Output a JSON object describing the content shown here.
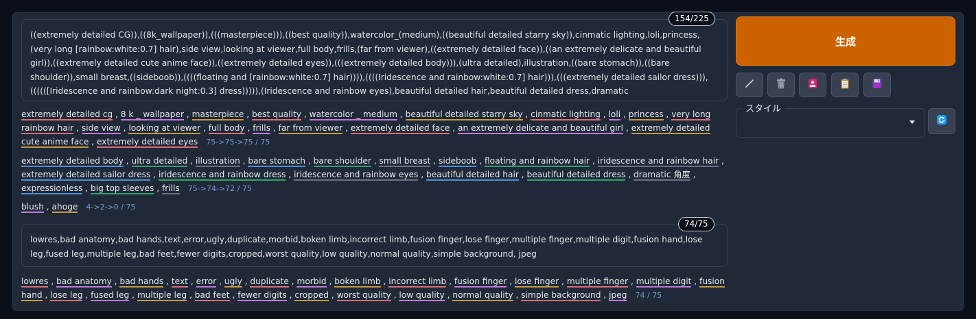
{
  "positive_prompt": {
    "counter": "154/225",
    "text": "((extremely detailed CG)),((8k_wallpaper)),(((masterpiece))),((best quality)),watercolor_(medium),((beautiful detailed starry sky)),cinmatic lighting,loli,princess,(very long [rainbow:white:0.7] hair),side view,looking at viewer,full body,frills,(far from viewer),((extremely detailed face)),((an extremely delicate and beautiful girl)),((extremely detailed cute anime face)),((extremely detailed eyes)),(((extremely detailed body))),(ultra detailed),illustration,((bare stomach)),((bare shoulder)),small breast,((sideboob)),((((floating and [rainbow:white:0.7] hair)))),((((Iridescence and rainbow:white:0.7] hair))),(((extremely detailed sailor dress))),((((([Iridescence and rainbow:dark night:0.3] dress))))),(Iridescence and rainbow eyes),beautiful detailed hair,beautiful detailed dress,dramatic angle,expressionless,(big top sleeves),frills,blush,(ahoge)"
  },
  "positive_tokens": [
    {
      "tokens": [
        "extremely detailed cg",
        "8 k _ wallpaper",
        "masterpiece",
        "best quality",
        "watercolor _ medium",
        "beautiful detailed starry sky",
        "cinmatic lighting",
        "loli",
        "princess",
        "very long rainbow hair",
        "side view",
        "looking at viewer",
        "full body",
        "frills",
        "far from viewer",
        "extremely detailed face",
        "an extremely delicate and beautiful girl",
        "extremely detailed cute anime face",
        "extremely detailed eyes"
      ],
      "count": "75->75->75 / 75"
    },
    {
      "tokens": [
        "extremely detailed body",
        "ultra detailed",
        "illustration",
        "bare stomach",
        "bare shoulder",
        "small breast",
        "sideboob",
        "floating and rainbow hair",
        "iridescence and rainbow hair",
        "extremely detailed sailor dress",
        "iridescence and rainbow dress",
        "iridescence and rainbow eyes",
        "beautiful detailed hair",
        "beautiful detailed dress",
        "dramatic 角度",
        "expressionless",
        "big top sleeves",
        "frills"
      ],
      "count": "75->74->72 / 75"
    },
    {
      "tokens": [
        "blush",
        "ahoge"
      ],
      "count": "4->2->0 / 75"
    }
  ],
  "negative_prompt": {
    "counter": "74/75",
    "text": "lowres,bad anatomy,bad hands,text,error,ugly,duplicate,morbid,boken limb,incorrect limb,fusion finger,lose finger,multiple finger,multiple digit,fusion hand,lose leg,fused leg,multiple leg,bad feet,fewer digits,cropped,worst quality,low quality,normal quality,simple background, jpeg"
  },
  "negative_tokens": [
    {
      "tokens": [
        "lowres",
        "bad anatomy",
        "bad hands",
        "text",
        "error",
        "ugly",
        "duplicate",
        "morbid",
        "boken limb",
        "incorrect limb",
        "fusion finger",
        "lose finger",
        "multiple finger",
        "multiple digit",
        "fusion hand",
        "lose leg",
        "fused leg",
        "multiple leg",
        "bad feet",
        "fewer digits",
        "cropped",
        "worst quality",
        "low quality",
        "normal quality",
        "simple background",
        "jpeg"
      ],
      "count": "74 / 75"
    }
  ],
  "actions": {
    "generate_label": "生成",
    "tools": [
      "pencil-icon",
      "trash-icon",
      "card-icon",
      "clipboard-icon",
      "save-icon"
    ]
  },
  "style": {
    "label": "スタイル",
    "selected": ""
  },
  "colors": {
    "generate": "#cc6200",
    "panel": "#1f2937",
    "background": "#0b0f19"
  }
}
